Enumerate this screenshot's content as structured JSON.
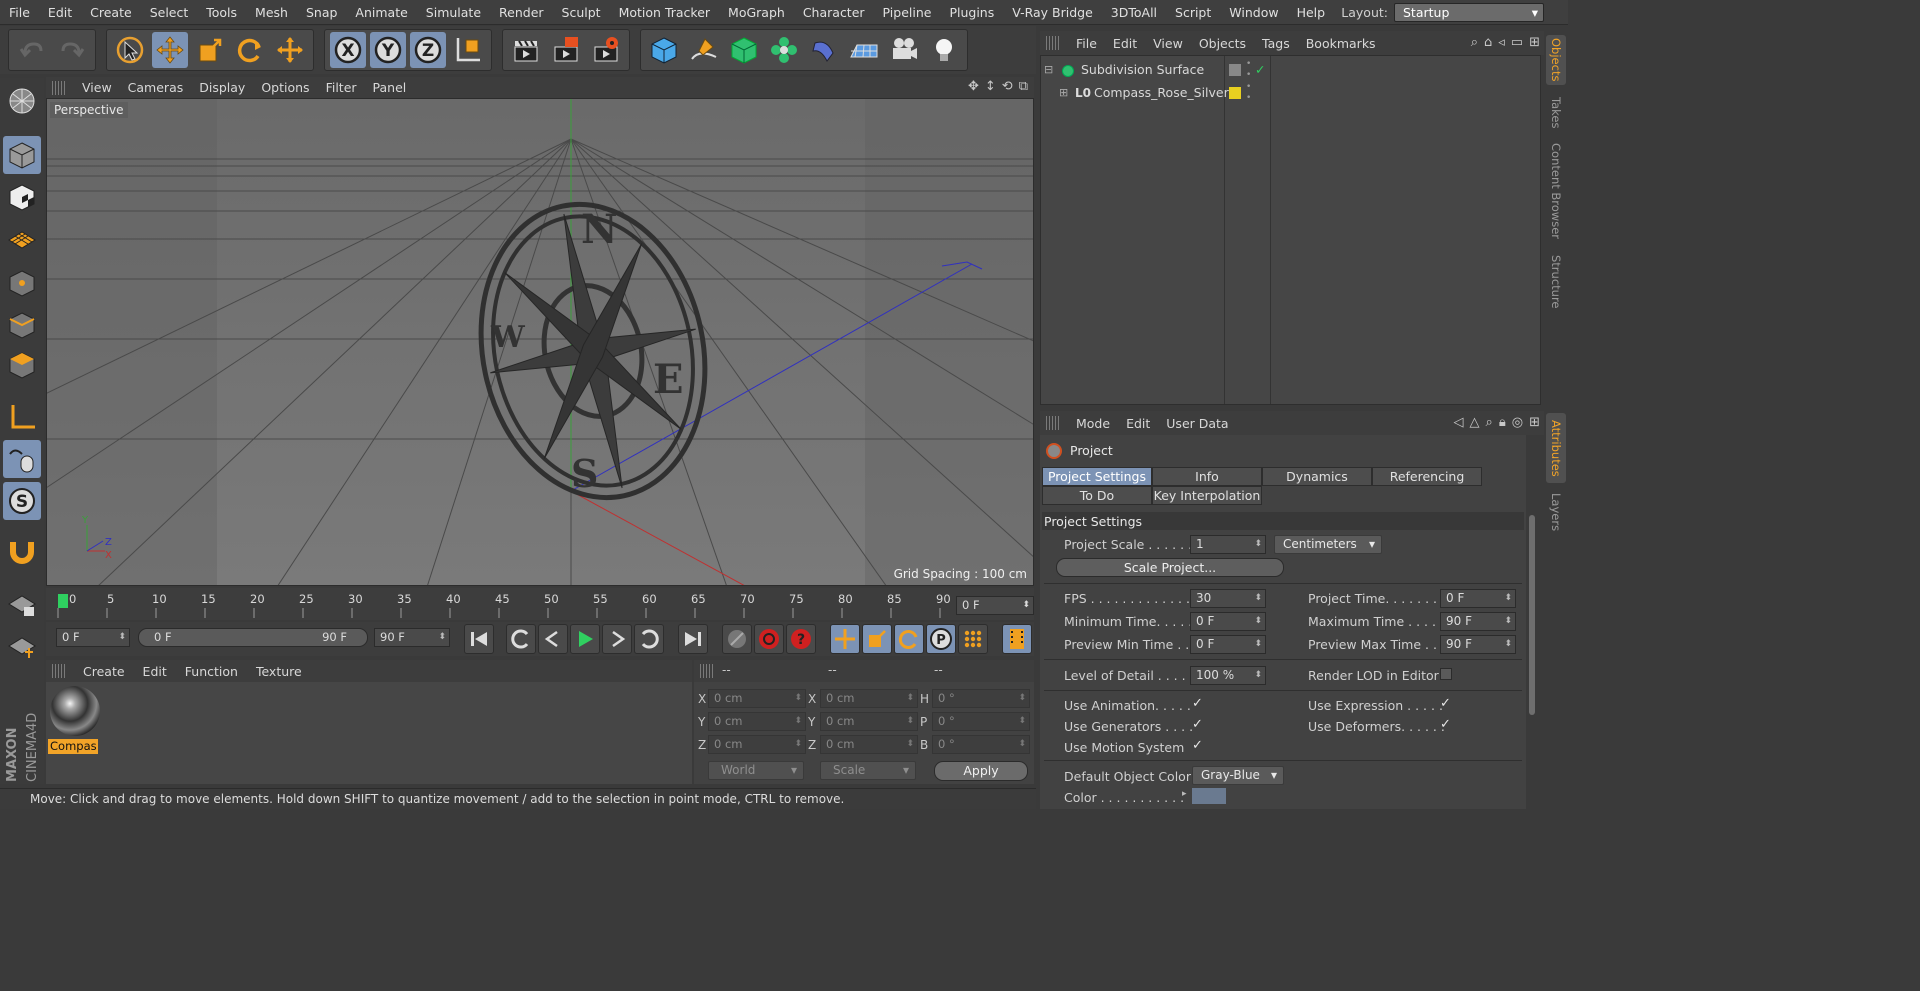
{
  "menubar": {
    "items": [
      "File",
      "Edit",
      "Create",
      "Select",
      "Tools",
      "Mesh",
      "Snap",
      "Animate",
      "Simulate",
      "Render",
      "Sculpt",
      "Motion Tracker",
      "MoGraph",
      "Character",
      "Pipeline",
      "Plugins",
      "V-Ray Bridge",
      "3DToAll",
      "Script",
      "Window",
      "Help"
    ],
    "layout_label": "Layout:",
    "layout_value": "Startup"
  },
  "viewport": {
    "menu": [
      "View",
      "Cameras",
      "Display",
      "Options",
      "Filter",
      "Panel"
    ],
    "label": "Perspective",
    "grid_spacing": "Grid Spacing : 100 cm",
    "compass_letters": {
      "n": "N",
      "e": "E",
      "s": "S",
      "w": "W"
    },
    "axis_labels": {
      "y": "Y",
      "z": "Z",
      "x": "X"
    }
  },
  "timeline": {
    "ticks": [
      "0",
      "5",
      "10",
      "15",
      "20",
      "25",
      "30",
      "35",
      "40",
      "45",
      "50",
      "55",
      "60",
      "65",
      "70",
      "75",
      "80",
      "85",
      "90"
    ],
    "current_frame": "0 F"
  },
  "transport": {
    "start_field": "0 F",
    "range_start": "0 F",
    "range_end": "90 F",
    "end_field": "90 F"
  },
  "materials": {
    "menu": [
      "Create",
      "Edit",
      "Function",
      "Texture"
    ],
    "items": [
      {
        "name": "Compas"
      }
    ]
  },
  "coordinates": {
    "headers": [
      "--",
      "--",
      "--"
    ],
    "rows": [
      {
        "l1": "X",
        "v1": "0 cm",
        "l2": "X",
        "v2": "0 cm",
        "l3": "H",
        "v3": "0 °"
      },
      {
        "l1": "Y",
        "v1": "0 cm",
        "l2": "Y",
        "v2": "0 cm",
        "l3": "P",
        "v3": "0 °"
      },
      {
        "l1": "Z",
        "v1": "0 cm",
        "l2": "Z",
        "v2": "0 cm",
        "l3": "B",
        "v3": "0 °"
      }
    ],
    "world": "World",
    "scale": "Scale",
    "apply": "Apply"
  },
  "status": "Move: Click and drag to move elements. Hold down SHIFT to quantize movement / add to the selection in point mode, CTRL to remove.",
  "objects": {
    "menu": [
      "File",
      "Edit",
      "View",
      "Objects",
      "Tags",
      "Bookmarks"
    ],
    "items": [
      {
        "name": "Subdivision Surface"
      },
      {
        "name": "Compass_Rose_Silver"
      }
    ]
  },
  "side_tabs": [
    "Objects",
    "Takes",
    "Content Browser",
    "Structure",
    "Attributes",
    "Layers"
  ],
  "attributes": {
    "menu": [
      "Mode",
      "Edit",
      "User Data"
    ],
    "title": "Project",
    "tabs": [
      "Project Settings",
      "Info",
      "Dynamics",
      "Referencing",
      "To Do",
      "Key Interpolation"
    ],
    "section": "Project Settings",
    "project_scale_label": "Project Scale . . . . . .",
    "project_scale_value": "1",
    "project_scale_unit": "Centimeters",
    "scale_project_btn": "Scale Project...",
    "fps_label": "FPS . . . . . . . . . . . . . . .",
    "fps_value": "30",
    "project_time_label": "Project Time. . . . . . . .",
    "project_time_value": "0 F",
    "min_time_label": "Minimum Time. . . . .",
    "min_time_value": "0 F",
    "max_time_label": "Maximum Time . . . . .",
    "max_time_value": "90 F",
    "prev_min_label": "Preview Min Time . .",
    "prev_min_value": "0 F",
    "prev_max_label": "Preview Max Time . . .",
    "prev_max_value": "90 F",
    "lod_label": "Level of Detail . . . . .",
    "lod_value": "100 %",
    "render_lod_label": "Render LOD in Editor",
    "use_animation": "Use Animation. . . . .",
    "use_expression": "Use Expression . . . . .",
    "use_generators": "Use Generators . . . .",
    "use_deformers": "Use Deformers. . . . . .",
    "use_motion": "Use Motion System",
    "default_color_label": "Default Object Color",
    "default_color_value": "Gray-Blue",
    "color_label": "Color . . . . . . . . . . .",
    "check_mark": "✓"
  },
  "colors": {
    "accent": "#7c93b5",
    "orange": "#f2a428",
    "panel": "#424242"
  }
}
